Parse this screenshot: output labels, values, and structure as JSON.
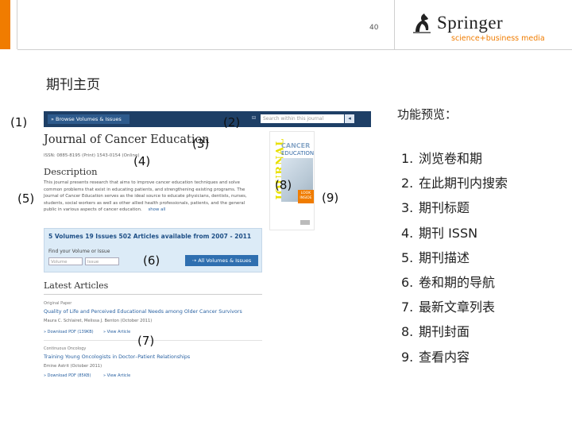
{
  "slide": {
    "page_number": "40",
    "title": "期刊主页",
    "brand": {
      "name": "Springer",
      "tagline": "science+business media",
      "accent_color": "#f07c00"
    }
  },
  "callouts": [
    "(1)",
    "(2)",
    "(3)",
    "(4)",
    "(5)",
    "(6)",
    "(7)",
    "(8)",
    "(9)"
  ],
  "journal_page": {
    "browse_label": "» Browse Volumes & Issues",
    "search_label": "⊟",
    "search_placeholder": "Search within this journal",
    "search_button": "◂",
    "title": "Journal of Cancer Education",
    "issn_line": "ISSN: 0885-8195 (Print) 1543-0154 (Online)",
    "description_heading": "Description",
    "description_text": "This journal presents research that aims to improve cancer education techniques and solve common problems that exist in educating patients, and strengthening existing programs. The Journal of Cancer Education serves as the ideal source to educate physicians, dentists, nurses, students, social workers as well as other allied health professionals, patients, and the general public in various aspects of cancer education.",
    "show_all": "show all",
    "cover": {
      "spine": "JOURNAL",
      "name_line1": "CANCER",
      "name_line2": "EDUCATION",
      "look_inside": "LOOK INSIDE"
    },
    "volume_stats": "5 Volumes 19 Issues 502 Articles available from 2007 - 2011",
    "find_label": "Find your Volume or Issue",
    "volume_placeholder": "Volume",
    "issue_placeholder": "Issue",
    "all_volumes_button": "⇢ All Volumes & Issues",
    "latest_heading": "Latest Articles",
    "articles": [
      {
        "type": "Original Paper",
        "title": "Quality of Life and Perceived Educational Needs among Older Cancer Survivors",
        "authors": "Maura C. Schlairet, Melissa J. Benton (October 2011)",
        "download": "» Download PDF (139KB)",
        "view": "» View Article"
      },
      {
        "type": "Continuous Oncology",
        "title": "Training Young Oncologists in Doctor–Patient Relationships",
        "authors": "Emine Astrit (October 2011)",
        "download": "» Download PDF (85KB)",
        "view": "» View Article"
      }
    ]
  },
  "features": {
    "heading": "功能预览：",
    "items": [
      {
        "num": "1.",
        "label": "浏览卷和期"
      },
      {
        "num": "2.",
        "label": "在此期刊内搜索"
      },
      {
        "num": "3.",
        "label": "期刊标题"
      },
      {
        "num": "4.",
        "label": "期刊 ISSN"
      },
      {
        "num": "5.",
        "label": "期刊描述"
      },
      {
        "num": "6.",
        "label": "卷和期的导航"
      },
      {
        "num": "7.",
        "label": "最新文章列表"
      },
      {
        "num": "8.",
        "label": "期刊封面"
      },
      {
        "num": "9.",
        "label": "查看内容"
      }
    ]
  }
}
